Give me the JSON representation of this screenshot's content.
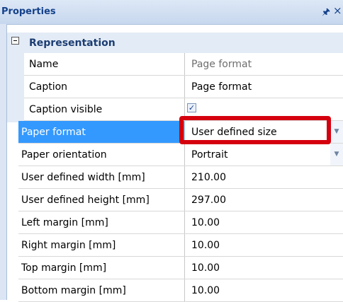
{
  "panel": {
    "title": "Properties",
    "pin_glyph": "Ⰿ",
    "close_glyph": "×"
  },
  "category": {
    "label": "Representation",
    "toggle_state": "expanded"
  },
  "properties": [
    {
      "name": "Name",
      "value": "Page format",
      "value_style": "grey"
    },
    {
      "name": "Caption",
      "value": "Page format"
    },
    {
      "name": "Caption visible",
      "checked": true
    },
    {
      "name": "Paper format",
      "value": "User defined size",
      "selected": true,
      "has_dropdown": true,
      "highlighted": true
    },
    {
      "name": "Paper orientation",
      "value": "Portrait",
      "has_dropdown": true
    },
    {
      "name": "User defined width [mm]",
      "value": "210.00"
    },
    {
      "name": "User defined height [mm]",
      "value": "297.00"
    },
    {
      "name": "Left margin [mm]",
      "value": "10.00"
    },
    {
      "name": "Right margin [mm]",
      "value": "10.00"
    },
    {
      "name": "Top margin [mm]",
      "value": "10.00"
    },
    {
      "name": "Bottom margin [mm]",
      "value": "10.00"
    }
  ],
  "colors": {
    "selection": "#3399ff",
    "highlight_border": "#d5000e",
    "category_text": "#1c3d72"
  }
}
